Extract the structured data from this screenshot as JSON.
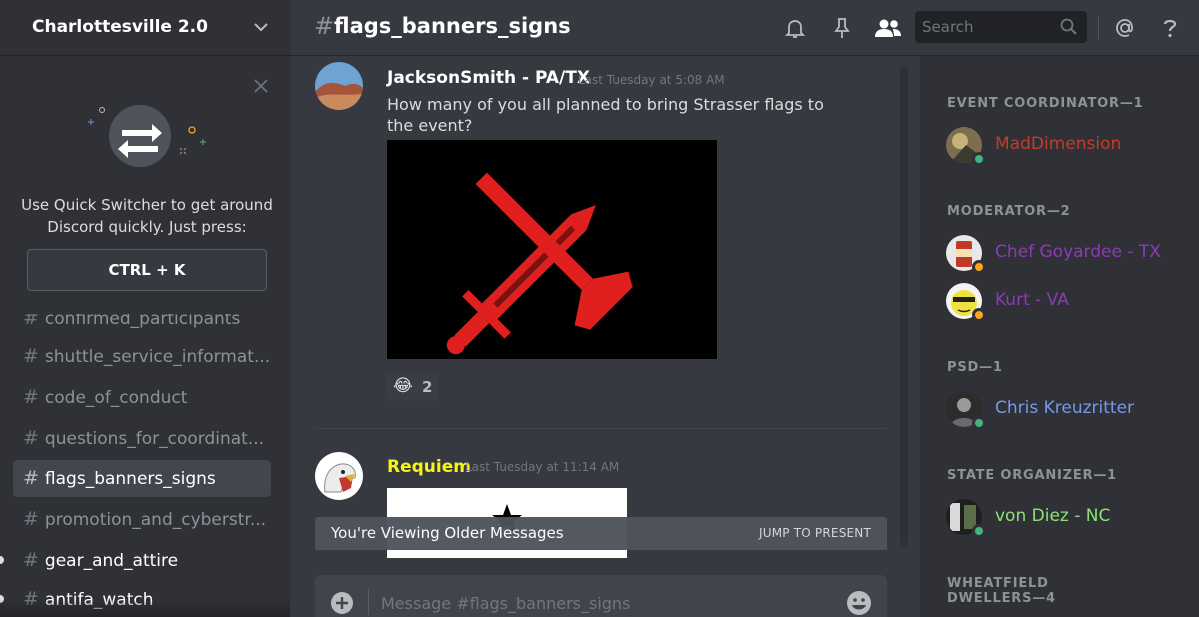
{
  "server": {
    "name": "Charlottesville 2.0"
  },
  "quick_switcher": {
    "message": "Use Quick Switcher to get around Discord quickly. Just press:",
    "shortcut": "CTRL + K"
  },
  "channels": [
    {
      "name": "confirmed_participants",
      "state": "muted"
    },
    {
      "name": "shuttle_service_informat...",
      "state": "normal"
    },
    {
      "name": "code_of_conduct",
      "state": "normal"
    },
    {
      "name": "questions_for_coordinat...",
      "state": "normal"
    },
    {
      "name": "flags_banners_signs",
      "state": "active"
    },
    {
      "name": "promotion_and_cyberstr...",
      "state": "normal"
    },
    {
      "name": "gear_and_attire",
      "state": "unread"
    },
    {
      "name": "antifa_watch",
      "state": "unread"
    }
  ],
  "header": {
    "hash": "#",
    "channel": "flags_banners_signs",
    "search_placeholder": "Search"
  },
  "icons": {
    "bell": "bell-icon",
    "pin": "pin-icon",
    "members": "members-icon",
    "search": "search-icon",
    "mention": "at-icon",
    "help": "help-icon"
  },
  "messages": [
    {
      "author": "JacksonSmith - PA/TX",
      "author_color": "#ffffff",
      "timestamp": "Last Tuesday at 5:08 AM",
      "text": "How many of you all planned to bring Strasser flags to the event?",
      "reaction": {
        "emoji": "😂",
        "count": "2"
      }
    },
    {
      "author": "Requiem",
      "author_color": "#f6f615",
      "timestamp": "Last Tuesday at 11:14 AM"
    }
  ],
  "older_banner": {
    "text": "You're Viewing Older Messages",
    "action": "JUMP TO PRESENT"
  },
  "composer": {
    "placeholder": "Message #flags_banners_signs"
  },
  "member_groups": [
    {
      "role": "EVENT COORDINATOR—1",
      "members": [
        {
          "name": "MadDimension",
          "color": "#c43b2b",
          "status": "online"
        }
      ]
    },
    {
      "role": "MODERATOR—2",
      "members": [
        {
          "name": "Chef Goyardee - TX",
          "color": "#8b3bb5",
          "status": "idle"
        },
        {
          "name": "Kurt - VA",
          "color": "#8b3bb5",
          "status": "idle"
        }
      ]
    },
    {
      "role": "PSD—1",
      "members": [
        {
          "name": "Chris Kreuzritter",
          "color": "#7a97e8",
          "status": "online"
        }
      ]
    },
    {
      "role": "STATE ORGANIZER—1",
      "members": [
        {
          "name": "von Diez - NC",
          "color": "#8ee07a",
          "status": "online"
        }
      ]
    },
    {
      "role": "WHEATFIELD DWELLERS—4",
      "members": []
    }
  ],
  "colors": {
    "online": "#43b581",
    "idle": "#faa61a",
    "accent_red": "#e01f1f"
  }
}
